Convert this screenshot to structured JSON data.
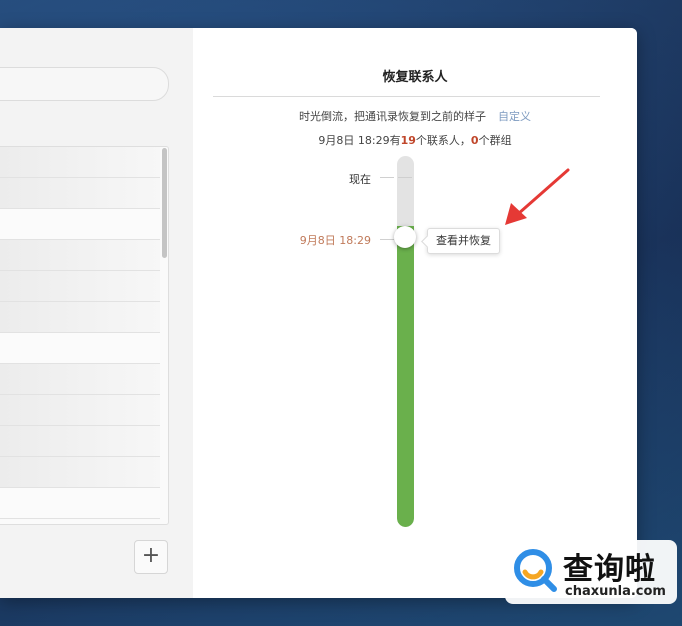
{
  "dialog": {
    "title": "恢复联系人",
    "description": "时光倒流，把通讯录恢复到之前的样子",
    "custom_link": "自定义",
    "summary": {
      "date": "9月8日 18:29",
      "has": "有",
      "contacts_count": "19",
      "contacts_text": "个联系人，",
      "groups_count": "0",
      "groups_text": "个群组"
    }
  },
  "timeline": {
    "now_label": "现在",
    "selected_label": "9月8日 18:29",
    "restore_button": "查看并恢复",
    "selected_fraction": 0.81
  },
  "left": {
    "add_button": "+"
  },
  "watermark": {
    "cn": "查询啦",
    "en": "chaxunla.com"
  },
  "colors": {
    "accent_green": "#6ab04c",
    "count_red": "#c0462a",
    "arrow_red": "#e53935",
    "link_blue": "#7e9bc0"
  }
}
